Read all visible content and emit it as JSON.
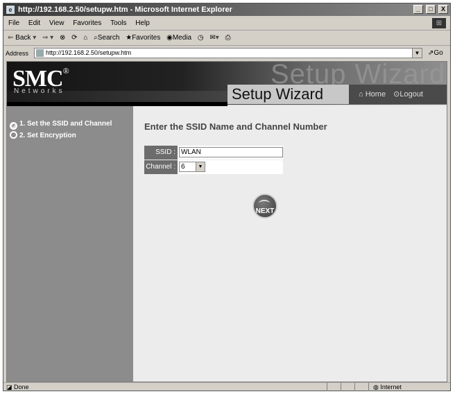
{
  "window": {
    "title": "http://192.168.2.50/setupw.htm - Microsoft Internet Explorer",
    "controls": [
      "_",
      "□",
      "X"
    ]
  },
  "menu": [
    "File",
    "Edit",
    "View",
    "Favorites",
    "Tools",
    "Help"
  ],
  "toolbar": {
    "back": "Back",
    "search": "Search",
    "favorites": "Favorites",
    "media": "Media"
  },
  "address": {
    "label": "Address",
    "url": "http://192.168.2.50/setupw.htm",
    "go": "Go"
  },
  "banner": {
    "brand": "SMC",
    "brand_mark": "®",
    "tagline": "Networks",
    "watermark": "Setup Wizard",
    "section": "Setup Wizard",
    "home": "Home",
    "logout": "Logout"
  },
  "steps": [
    {
      "label": "1. Set the SSID and Channel",
      "done": true
    },
    {
      "label": "2. Set Encryption",
      "done": false
    }
  ],
  "form": {
    "heading": "Enter the SSID Name and Channel Number",
    "ssid_label": "SSID :",
    "ssid_value": "WLAN",
    "channel_label": "Channel :",
    "channel_value": "6",
    "next_label": "NEXT"
  },
  "status": {
    "text": "Done",
    "zone": "Internet"
  }
}
